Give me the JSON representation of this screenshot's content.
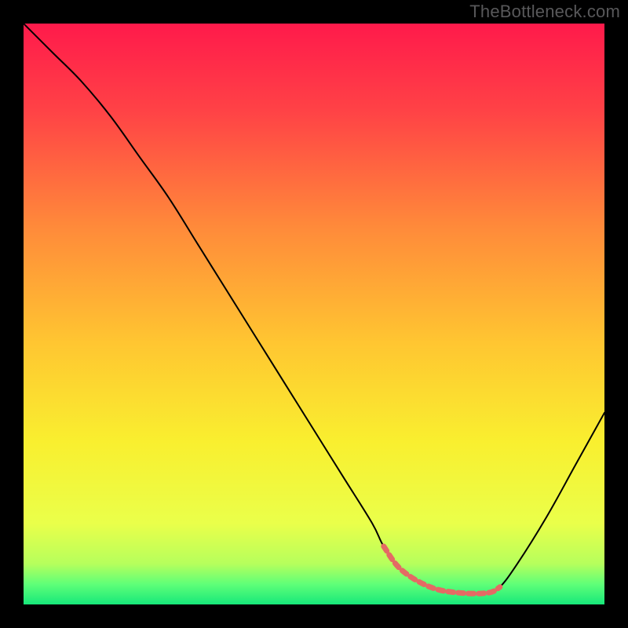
{
  "watermark": {
    "text": "TheBottleneck.com"
  },
  "chart_data": {
    "type": "line",
    "title": "",
    "xlabel": "",
    "ylabel": "",
    "xlim": [
      0,
      100
    ],
    "ylim": [
      0,
      100
    ],
    "grid": false,
    "legend": false,
    "background": {
      "kind": "vertical-gradient",
      "stops": [
        {
          "pos": 0.0,
          "color": "#ff1a4b"
        },
        {
          "pos": 0.15,
          "color": "#ff4246"
        },
        {
          "pos": 0.35,
          "color": "#ff8a3a"
        },
        {
          "pos": 0.55,
          "color": "#ffc631"
        },
        {
          "pos": 0.72,
          "color": "#f9ef2f"
        },
        {
          "pos": 0.86,
          "color": "#eaff4a"
        },
        {
          "pos": 0.93,
          "color": "#b6ff5c"
        },
        {
          "pos": 0.965,
          "color": "#5fff78"
        },
        {
          "pos": 1.0,
          "color": "#17e87a"
        }
      ]
    },
    "series": [
      {
        "name": "bottleneck-curve",
        "color": "#000000",
        "width": 2,
        "x": [
          0,
          5,
          10,
          15,
          20,
          25,
          30,
          35,
          40,
          45,
          50,
          55,
          60,
          62,
          65,
          70,
          75,
          80,
          82,
          85,
          90,
          95,
          100
        ],
        "y": [
          100,
          95,
          90,
          84,
          77,
          70,
          62,
          54,
          46,
          38,
          30,
          22,
          14,
          10,
          6,
          3,
          2,
          2,
          3,
          7,
          15,
          24,
          33
        ]
      },
      {
        "name": "flat-region-highlight",
        "color": "#e46a64",
        "width": 7,
        "dash": "7 6",
        "x": [
          62,
          65,
          70,
          75,
          80,
          82
        ],
        "y": [
          10,
          6,
          3,
          2,
          2,
          3
        ]
      }
    ],
    "annotations": []
  }
}
